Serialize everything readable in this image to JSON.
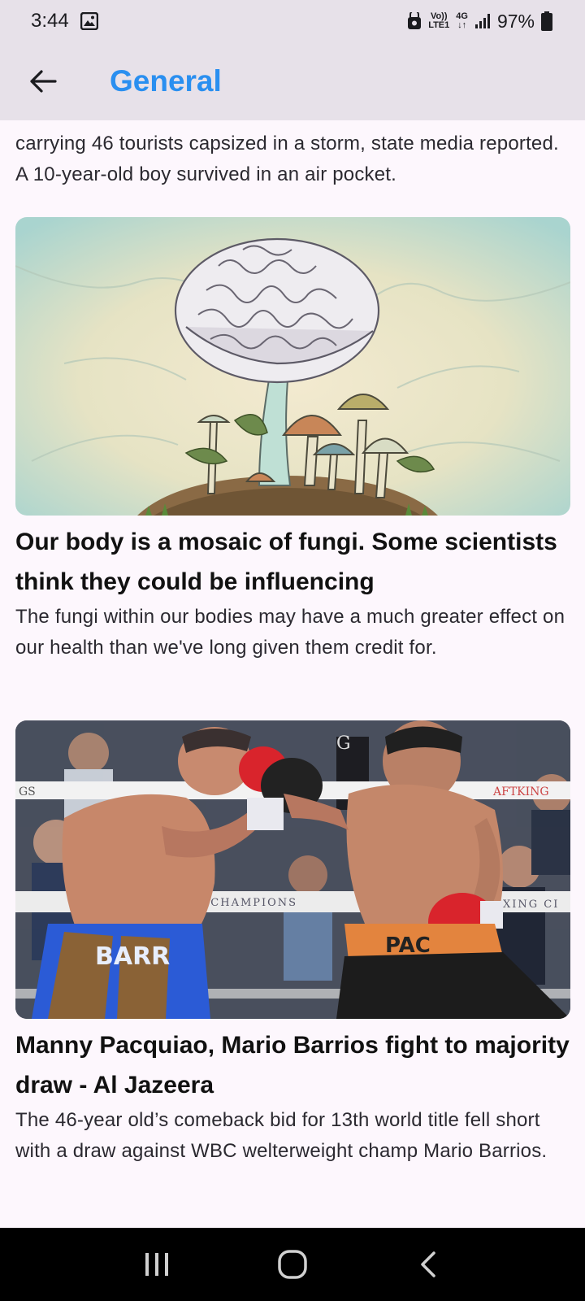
{
  "status_bar": {
    "time": "3:44",
    "network_top": "Vo))",
    "network_bottom": "LTE1",
    "network_type": "4G",
    "battery": "97%"
  },
  "app_bar": {
    "title": "General",
    "title_color": "#2a8ff0"
  },
  "articles": [
    {
      "description": "carrying 46 tourists capsized in a storm, state media reported. A 10-year-old boy survived in an air pocket."
    },
    {
      "title": "Our body is a mosaic of fungi. Some scientists think they could be influencing",
      "description": "The fungi within our bodies may have a much greater effect on our health than we've long given them credit for.",
      "image": "brain-mushroom-illustration"
    },
    {
      "title": "Manny Pacquiao, Mario Barrios fight to majority draw - Al Jazeera",
      "description": "The 46-year old’s comeback bid for 13th world title fell short with a draw against WBC welterweight champ Mario Barrios.",
      "image": "boxing-match-photo",
      "image_text": {
        "ring_left": "GS",
        "ring_right": "AFTKING",
        "rope_middle": "XING CHAMPIONS",
        "rope_right": "XING CI",
        "trunks_left": "BARR",
        "trunks_right": "PAC",
        "letters_top": "G"
      }
    }
  ],
  "nav_bar": {
    "recents": "recents-icon",
    "home": "home-icon",
    "back": "back-icon"
  }
}
